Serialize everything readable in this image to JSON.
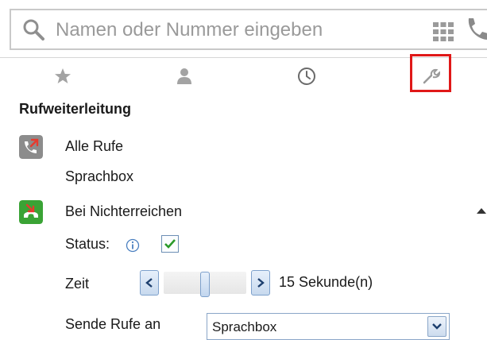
{
  "search": {
    "placeholder": "Namen oder Nummer eingeben"
  },
  "tabs": [
    {
      "icon": "star-icon"
    },
    {
      "icon": "person-icon"
    },
    {
      "icon": "clock-icon"
    },
    {
      "icon": "wrench-icon",
      "highlighted": true
    }
  ],
  "section": {
    "title": "Rufweiterleitung"
  },
  "forwarding": {
    "all_calls": {
      "label": "Alle Rufe",
      "target": "Sprachbox"
    },
    "no_answer": {
      "label": "Bei Nichterreichen",
      "status_label": "Status:",
      "status_checked": true,
      "time_label": "Zeit",
      "time_value": "15 Sekunde(n)",
      "send_label": "Sende Rufe an",
      "send_value": "Sprachbox"
    }
  },
  "colors": {
    "highlight": "#e01818",
    "call_green": "#3aa335",
    "call_gray": "#8c8c8c",
    "accent_blue": "#7ea1cc"
  }
}
